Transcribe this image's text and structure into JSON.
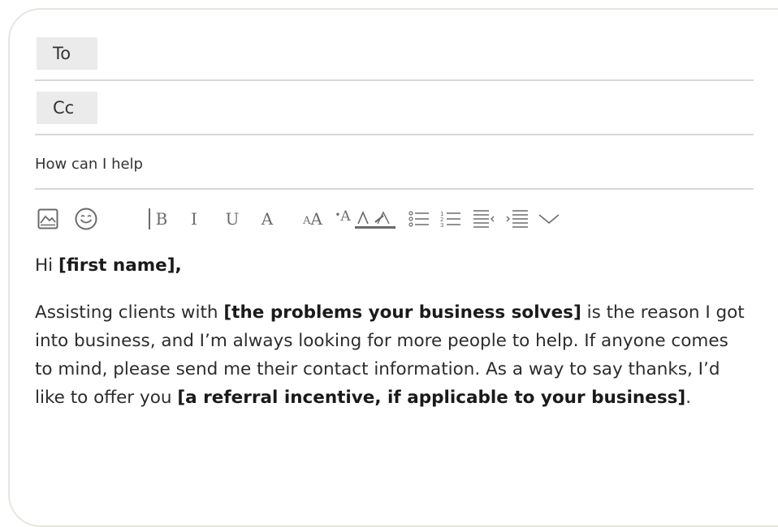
{
  "fields": {
    "to_label": "To",
    "cc_label": "Cc",
    "subject": "How can I help"
  },
  "toolbar": {
    "items": [
      {
        "name": "insert-image-icon"
      },
      {
        "name": "emoji-icon"
      },
      {
        "name": "bold-button",
        "glyph": "B"
      },
      {
        "name": "italic-button",
        "glyph": "I"
      },
      {
        "name": "underline-button",
        "glyph": "U"
      },
      {
        "name": "font-button",
        "glyph": "A"
      },
      {
        "name": "font-size-button",
        "glyph_small": "A",
        "glyph_large": "A"
      },
      {
        "name": "superscript-button",
        "glyph": "A"
      },
      {
        "name": "text-color-button",
        "glyph": "A"
      },
      {
        "name": "bullet-list-icon"
      },
      {
        "name": "numbered-list-icon"
      },
      {
        "name": "outdent-icon"
      },
      {
        "name": "indent-icon"
      },
      {
        "name": "more-options-chevron-icon"
      }
    ]
  },
  "message": {
    "greeting_prefix": "Hi ",
    "greeting_name": "[first name],",
    "p1": "Assisting clients with ",
    "p1_bold": "[the problems your business solves]",
    "p2": " is the reason I got into business, and I’m always looking for more people to help. If anyone comes to mind, please send me their contact information. As a way to say thanks, I’d like to offer you ",
    "p2_bold": "[a referral incentive, if applicable to your business]",
    "p3": "."
  },
  "colors": {
    "card_border": "#e7e5de",
    "field_tag_bg": "#ebebeb",
    "divider": "#d8d8d8",
    "toolbar_icon": "#6b6b6b",
    "text": "#2c2c2c"
  }
}
